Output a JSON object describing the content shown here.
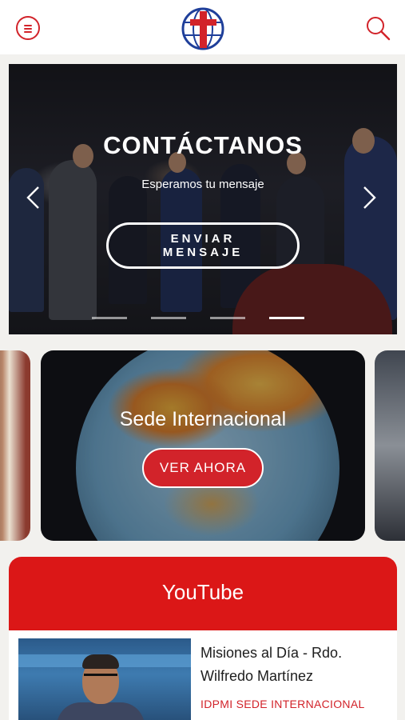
{
  "header": {
    "menu_icon": "hamburger-menu-icon",
    "logo_icon": "globe-cross-logo",
    "search_icon": "search-icon",
    "accent_color": "#d2232a"
  },
  "hero": {
    "title": "CONTÁCTANOS",
    "subtitle": "Esperamos tu mensaje",
    "cta_line1": "ENVIAR",
    "cta_line2": "MENSAJE",
    "prev_icon": "chevron-left-icon",
    "next_icon": "chevron-right-icon",
    "slide_count": 4,
    "active_slide": 4
  },
  "cards": {
    "main_title": "Sede Internacional",
    "main_cta": "VER AHORA"
  },
  "youtube": {
    "section_title": "YouTube",
    "header_color": "#db1717",
    "video": {
      "title": "Misiones al Día - Rdo. Wilfredo Martínez",
      "channel": "IDPMI SEDE INTERNACIONAL"
    }
  }
}
